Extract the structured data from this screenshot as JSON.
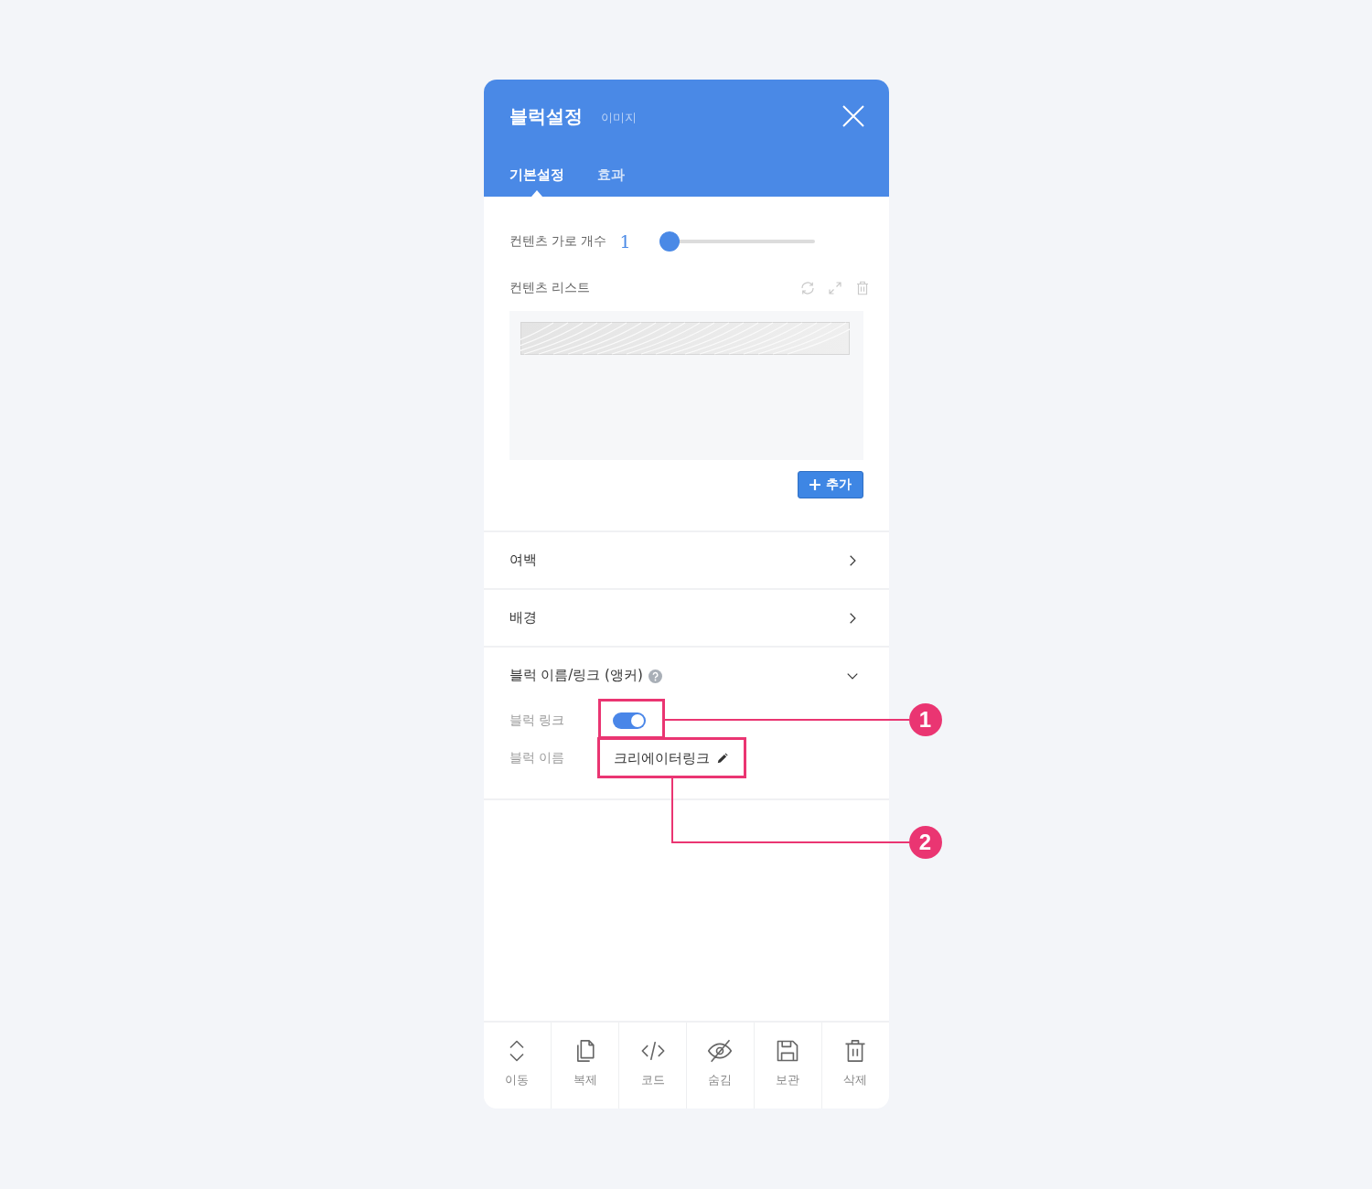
{
  "header": {
    "title": "블럭설정",
    "subtitle": "이미지"
  },
  "tabs": [
    {
      "label": "기본설정",
      "selected": true
    },
    {
      "label": "효과",
      "selected": false
    }
  ],
  "columns_setting": {
    "label": "컨텐츠 가로 개수",
    "value": "1",
    "level": 0
  },
  "content_list": {
    "label": "컨텐츠 리스트",
    "items": [
      {
        "kind": "image"
      }
    ]
  },
  "add_button": {
    "label": "추가"
  },
  "sections": [
    {
      "label": "여백",
      "expanded": false,
      "help": false
    },
    {
      "label": "배경",
      "expanded": false,
      "help": false
    },
    {
      "label": "블럭 이름/링크 (앵커)",
      "expanded": true,
      "help": true,
      "fields": [
        {
          "kind": "toggle",
          "label": "블럭 링크",
          "on": true
        },
        {
          "kind": "text",
          "label": "블럭 이름",
          "value": "크리에이터링크"
        }
      ]
    }
  ],
  "toolbar": [
    {
      "kind": "move",
      "label": "이동"
    },
    {
      "kind": "copy",
      "label": "복제"
    },
    {
      "kind": "code",
      "label": "코드"
    },
    {
      "kind": "hide",
      "label": "숨김"
    },
    {
      "kind": "save",
      "label": "보관"
    },
    {
      "kind": "delete",
      "label": "삭제"
    }
  ],
  "callouts": [
    {
      "number": "1"
    },
    {
      "number": "2"
    }
  ]
}
